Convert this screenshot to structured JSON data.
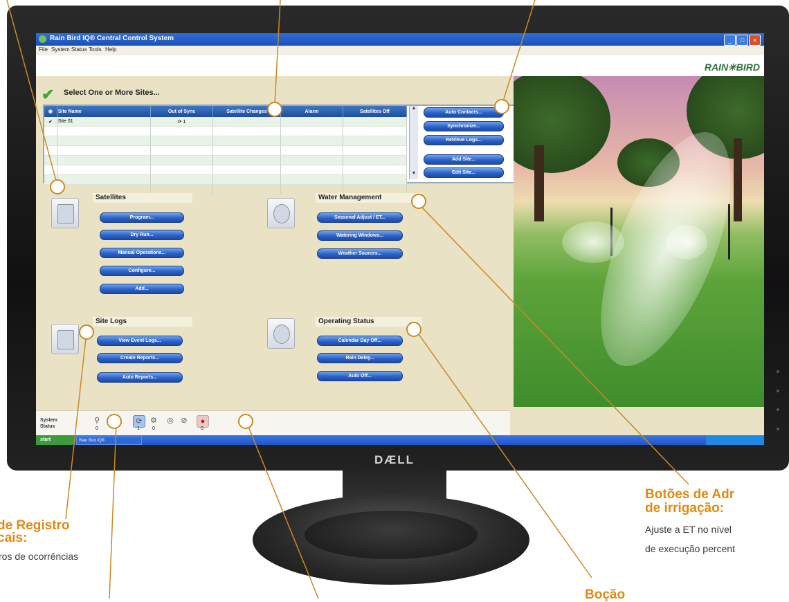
{
  "window": {
    "title": "Rain Bird IQ® Central Control System",
    "brand": "RAIN✳BIRD",
    "menu": [
      "File",
      "System Status",
      "Tools",
      "Help"
    ]
  },
  "header": {
    "title": "Select One or More Sites..."
  },
  "sites_table": {
    "columns": [
      "Site Name",
      "Out of Sync",
      "Satellite Changes",
      "Alarm",
      "Satellites Off"
    ],
    "rows": [
      {
        "site_name": "Site 01",
        "out_of_sync": "1",
        "satellite_changes": "",
        "alarm": "",
        "satellites_off": ""
      }
    ]
  },
  "site_buttons": [
    "Auto Contacts...",
    "Synchronize...",
    "Retrieve Logs...",
    "Add Site...",
    "Edit Site..."
  ],
  "satellites": {
    "title": "Satellites",
    "buttons": [
      "Program...",
      "Dry Run...",
      "Manual Operations...",
      "Configure...",
      "Add..."
    ]
  },
  "water_management": {
    "title": "Water Management",
    "buttons": [
      "Seasonal Adjust / ET...",
      "Watering Windows...",
      "Weather Sources..."
    ]
  },
  "site_logs": {
    "title": "Site Logs",
    "buttons": [
      "View Event Logs...",
      "Create Reports...",
      "Auto Reports..."
    ]
  },
  "operating_status": {
    "title": "Operating Status",
    "buttons": [
      "Calendar Day Off...",
      "Rain Delay...",
      "Auto Off..."
    ]
  },
  "status_bar": {
    "label_line1": "System",
    "label_line2": "Status",
    "counts": [
      "0",
      "1",
      "0",
      "0"
    ]
  },
  "taskbar": {
    "start": "start",
    "task": "Rain Bird IQ®"
  },
  "monitor": {
    "brand": "DÆLL"
  },
  "annotations": {
    "logs_title_1": "de Registro",
    "logs_title_2": "cais:",
    "logs_text": "ros de ocorrências",
    "admin_title_1": "Botões de Adr",
    "admin_title_2": "de irrigação:",
    "admin_text_1": "Ajuste a ET no nível",
    "admin_text_2": "de execução percent",
    "bottom_fragment": "Boção"
  },
  "colors": {
    "accent": "#e08a12",
    "button": "#2c62c8",
    "panel": "#e9e2c5"
  }
}
